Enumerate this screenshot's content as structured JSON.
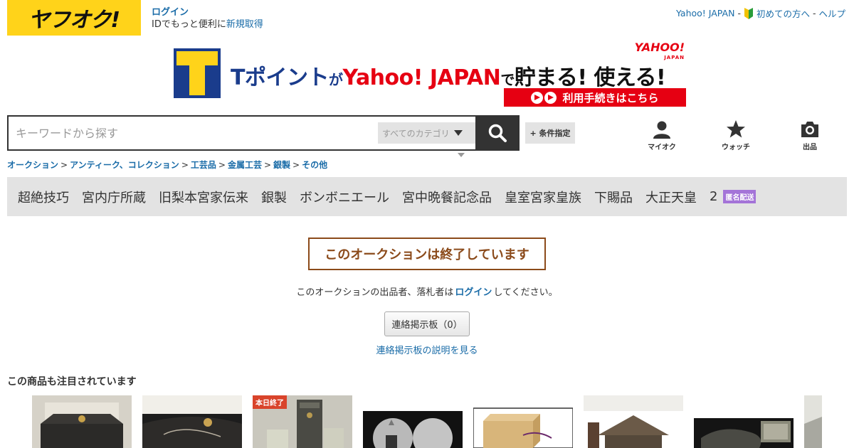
{
  "header": {
    "logo_text": "ヤフオク!",
    "login_label": "ログイン",
    "id_prompt": "IDでもっと便利に",
    "register_link": "新規取得",
    "yahoo_japan_link": "Yahoo! JAPAN",
    "dash": "-",
    "beginners_link": "初めての方へ",
    "help_link": "ヘルプ"
  },
  "banner": {
    "t_logo": "T",
    "part1": "Tポイント",
    "part2": "が",
    "part3": "Yahoo! JAPAN",
    "part4": "で",
    "part5": "貯まる! 使える!",
    "yahoo_mini": "YAHOO!",
    "japan_mini": "JAPAN",
    "cta": "利用手続きはこちら"
  },
  "search": {
    "placeholder": "キーワードから探す",
    "category": "すべてのカテゴリ",
    "conditions_button": "+ 条件指定"
  },
  "nav_icons": {
    "myauction": "マイオク",
    "watch": "ウォッチ",
    "sell": "出品"
  },
  "breadcrumb": [
    "オークション",
    "アンティーク、コレクション",
    "工芸品",
    "金属工芸",
    "銀製",
    "その他"
  ],
  "breadcrumb_sep": ">",
  "tags": [
    "超絶技巧",
    "宮内庁所蔵",
    "旧梨本宮家伝来",
    "銀製",
    "ボンボニエール",
    "宮中晩餐記念品",
    "皇室宮家皇族",
    "下賜品",
    "大正天皇",
    "2"
  ],
  "anon_badge": "匿名配送",
  "notice": {
    "ended": "このオークションは終了しています",
    "msg_before": "このオークションの出品者、落札者は",
    "msg_link": "ログイン",
    "msg_after": "してください。",
    "board_button": "連絡掲示板（0）",
    "board_help": "連絡掲示板の説明を見る"
  },
  "recommended": {
    "title": "この商品も注目されています",
    "ended_today_badge": "本日終了"
  },
  "colors": {
    "logo_yellow": "#ffd31a",
    "link_blue": "#1a6ca8",
    "ended_brown": "#8b4a1a",
    "tag_bg": "#e3e3e3",
    "anon_purple": "#a474d8",
    "promo_red": "#e60012"
  }
}
